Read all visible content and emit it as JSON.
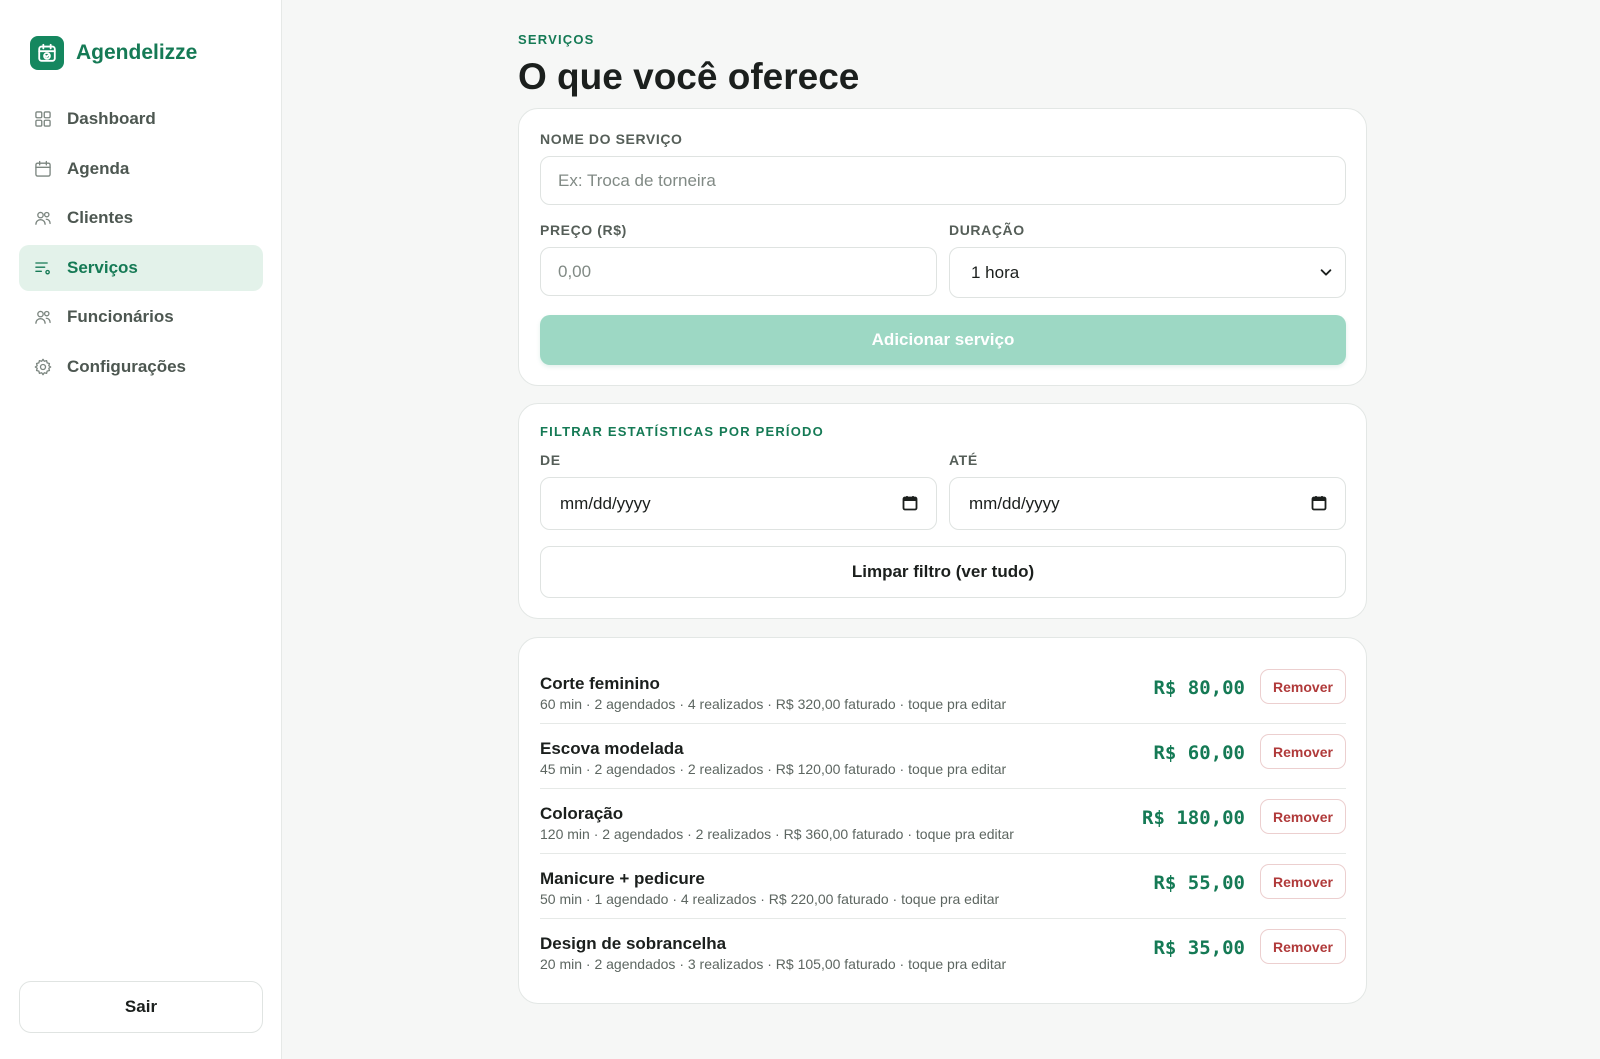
{
  "brand": {
    "name": "Agendelizze"
  },
  "nav": {
    "items": [
      {
        "label": "Dashboard",
        "icon": "grid-icon"
      },
      {
        "label": "Agenda",
        "icon": "calendar-icon"
      },
      {
        "label": "Clientes",
        "icon": "users-icon"
      },
      {
        "label": "Serviços",
        "icon": "list-icon",
        "active": true
      },
      {
        "label": "Funcionários",
        "icon": "staff-icon"
      },
      {
        "label": "Configurações",
        "icon": "gear-icon"
      }
    ]
  },
  "logout_label": "Sair",
  "header": {
    "eyebrow": "SERVIÇOS",
    "title": "O que você oferece"
  },
  "form": {
    "name_label": "NOME DO SERVIÇO",
    "name_placeholder": "Ex: Troca de torneira",
    "price_label": "PREÇO (R$)",
    "price_placeholder": "0,00",
    "duration_label": "DURAÇÃO",
    "duration_value": "1 hora",
    "submit_label": "Adicionar serviço"
  },
  "filter": {
    "title": "FILTRAR ESTATÍSTICAS POR PERÍODO",
    "from_label": "DE",
    "from_value": "mm/dd/yyyy",
    "to_label": "ATÉ",
    "to_value": "mm/dd/yyyy",
    "clear_label": "Limpar filtro (ver tudo)"
  },
  "services": [
    {
      "name": "Corte feminino",
      "meta": "60 min · 2 agendados · 4 realizados · R$ 320,00 faturado · toque pra editar",
      "price": "R$ 80,00",
      "remove_label": "Remover"
    },
    {
      "name": "Escova modelada",
      "meta": "45 min · 2 agendados · 2 realizados · R$ 120,00 faturado · toque pra editar",
      "price": "R$ 60,00",
      "remove_label": "Remover"
    },
    {
      "name": "Coloração",
      "meta": "120 min · 2 agendados · 2 realizados · R$ 360,00 faturado · toque pra editar",
      "price": "R$ 180,00",
      "remove_label": "Remover"
    },
    {
      "name": "Manicure + pedicure",
      "meta": "50 min · 1 agendado · 4 realizados · R$ 220,00 faturado · toque pra editar",
      "price": "R$ 55,00",
      "remove_label": "Remover"
    },
    {
      "name": "Design de sobrancelha",
      "meta": "20 min · 2 agendados · 3 realizados · R$ 105,00 faturado · toque pra editar",
      "price": "R$ 35,00",
      "remove_label": "Remover"
    }
  ],
  "colors": {
    "accent": "#157a55",
    "accent_light": "#e3f2ea",
    "button_disabled": "#9dd8c4",
    "danger": "#b03a3a"
  }
}
